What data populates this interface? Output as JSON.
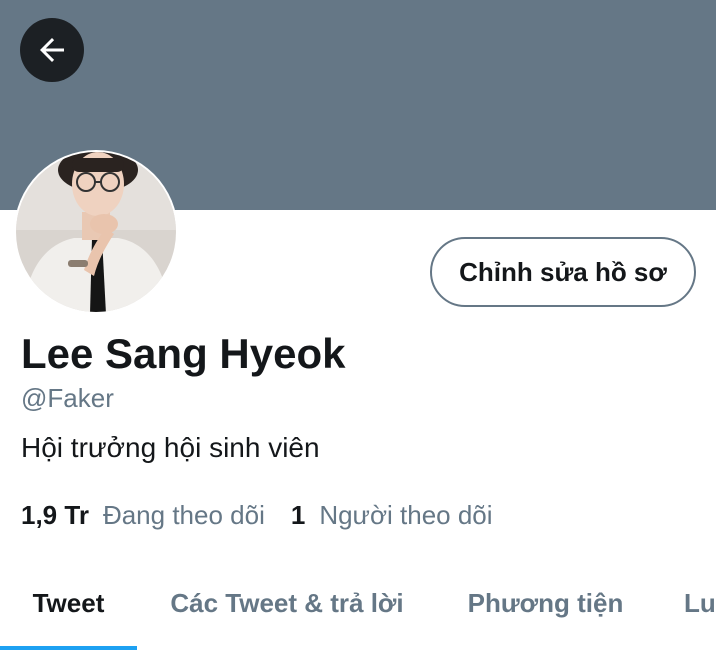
{
  "header": {
    "back_icon": "arrow-left-icon",
    "banner_color": "#657786"
  },
  "profile": {
    "display_name": "Lee Sang Hyeok",
    "handle": "@Faker",
    "bio": "Hội trưởng hội sinh viên",
    "edit_button_label": "Chỉnh sửa hồ sơ",
    "avatar": "profile-photo"
  },
  "stats": {
    "following_count": "1,9 Tr",
    "following_label": "Đang theo dõi",
    "followers_count": "1",
    "followers_label": "Người theo dõi"
  },
  "tabs": [
    {
      "label": "Tweet",
      "active": true
    },
    {
      "label": "Các Tweet & trả lời",
      "active": false
    },
    {
      "label": "Phương tiện",
      "active": false
    },
    {
      "label": "Lu",
      "active": false
    }
  ],
  "colors": {
    "accent": "#1da1f2",
    "secondary_text": "#657786",
    "primary_text": "#14171a"
  }
}
